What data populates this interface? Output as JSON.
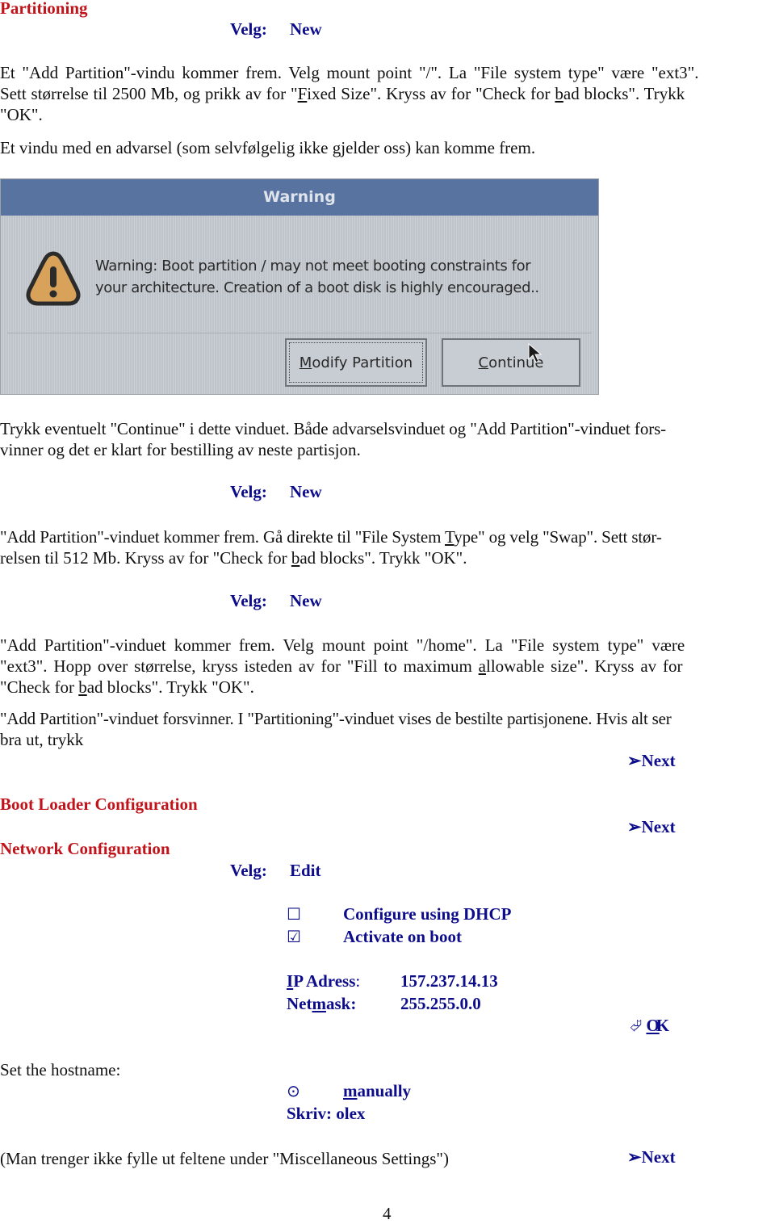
{
  "page_number": "4",
  "partitioning": {
    "heading": "Partitioning",
    "step1": {
      "velg_label": "Velg:",
      "action": "New"
    },
    "para1": {
      "l1": "Et \"Add Partition\"-vindu kommer frem. Velg mount point \"/\". La \"File system type\" være \"ext3\".",
      "l2a": "Sett størrelse til 2500 Mb, og prikk av for \"",
      "l2_u": "F",
      "l2b": "ixed Size\".  Kryss av for \"Check for ",
      "l2_u2": "b",
      "l2c": "ad blocks\". Trykk",
      "l3": "\"OK\"."
    },
    "para2": "Et vindu med en advarsel (som selvfølgelig ikke gjelder oss) kan komme frem.",
    "warning_dialog": {
      "title": "Warning",
      "icon": "warning-triangle-icon",
      "message_line1": "Warning: Boot partition / may not meet booting constraints for",
      "message_line2": "your architecture.  Creation of a boot disk is highly encouraged..",
      "buttons": [
        {
          "underline": "M",
          "rest": "odify Partition"
        },
        {
          "underline": "C",
          "rest": "ontinue"
        }
      ]
    },
    "para3": {
      "l1": "Trykk eventuelt \"Continue\" i dette vinduet. Både advarselsvinduet og \"Add Partition\"-vinduet fors-",
      "l2": "vinner og det er klart for bestilling av neste partisjon."
    },
    "step2": {
      "velg_label": "Velg:",
      "action": "New"
    },
    "para4": {
      "l1a": "\"Add Partition\"-vinduet kommer frem. Gå direkte til \"File System ",
      "l1_u": "T",
      "l1b": "ype\" og velg \"Swap\". Sett stør-",
      "l2a": "relsen til 512 Mb. Kryss av for \"Check for ",
      "l2_u": "b",
      "l2b": "ad blocks\". Trykk \"OK\"."
    },
    "step3": {
      "velg_label": "Velg:",
      "action": "New"
    },
    "para5": {
      "l1": "\"Add Partition\"-vinduet kommer frem. Velg mount point  \"/home\". La \"File system type\" være",
      "l2a": "\"ext3\". Hopp over størrelse, kryss isteden av for \"Fill to maximum ",
      "l2_u": "a",
      "l2b": "llowable size\". Kryss av for",
      "l3a": "\"Check for ",
      "l3_u": "b",
      "l3b": "ad blocks\". Trykk \"OK\"."
    },
    "para6": {
      "l1": "\"Add Partition\"-vinduet forsvinner. I \"Partitioning\"-vinduet vises de bestilte partisjonene. Hvis alt ser",
      "l2": "bra ut, trykk"
    },
    "next1": {
      "icon": "➢",
      "label": "Next"
    }
  },
  "boot_loader": {
    "heading": "Boot Loader Configuration",
    "next": {
      "icon": "➢",
      "label": "Next"
    }
  },
  "network": {
    "heading": "Network Configuration",
    "step": {
      "velg_label": "Velg:",
      "action": "Edit"
    },
    "checkboxes": [
      {
        "glyph": "☐",
        "label": "Configure using DHCP",
        "checked": false
      },
      {
        "glyph": "☑",
        "label": "Activate on boot",
        "checked": true
      }
    ],
    "ip": {
      "label_u": "I",
      "label_rest": "P Adress",
      "colon": ":",
      "value": "157.237.14.13"
    },
    "netmask": {
      "label_a": "Net",
      "label_u": "m",
      "label_b": "ask:",
      "value": "255.255.0.0"
    },
    "ok": {
      "icon": "⮰",
      "label_u": "O",
      "label_rest": "K"
    },
    "hostname_label": "Set the hostname:",
    "radio": {
      "glyph": "⊙",
      "label_u": "m",
      "label_rest": "anually",
      "selected": true
    },
    "skriv": {
      "label": "Skriv:",
      "value": "olex"
    },
    "misc_note": "(Man trenger ikke fylle ut feltene under \"Miscellaneous Settings\")",
    "next": {
      "icon": "➢",
      "label": "Next"
    }
  }
}
